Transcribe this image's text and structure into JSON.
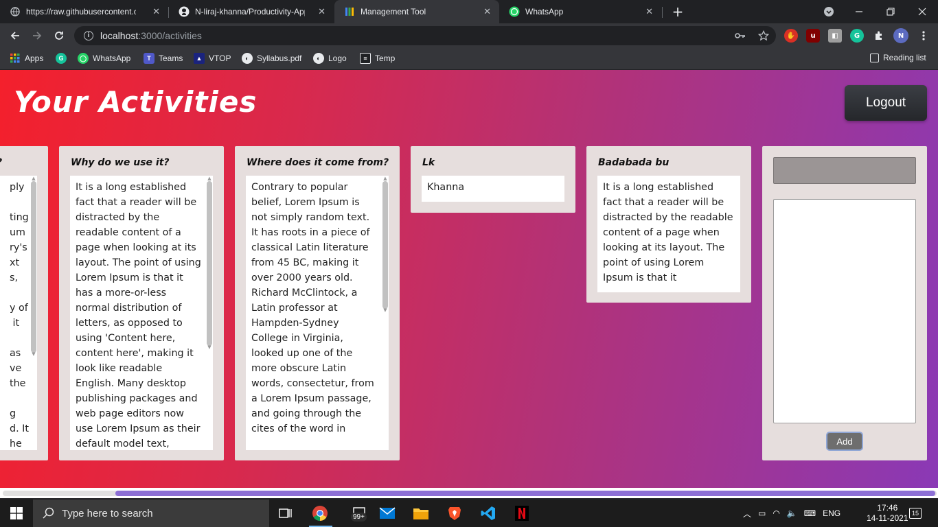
{
  "browser": {
    "tabs": [
      {
        "title": "https://raw.githubusercontent.co",
        "icon": "globe-icon"
      },
      {
        "title": "N-liraj-khanna/Productivity-App",
        "icon": "github-icon"
      },
      {
        "title": "Management Tool",
        "icon": "app-icon"
      },
      {
        "title": "WhatsApp",
        "icon": "whatsapp-icon"
      }
    ],
    "new_tab": "+",
    "close": "✕",
    "url_host": "localhost",
    "url_path": ":3000/activities",
    "bookmarks": [
      {
        "label": "Apps"
      },
      {
        "label": ""
      },
      {
        "label": "WhatsApp"
      },
      {
        "label": "Teams"
      },
      {
        "label": "VTOP"
      },
      {
        "label": "Syllabus.pdf"
      },
      {
        "label": "Logo"
      },
      {
        "label": "Temp"
      }
    ],
    "reading_list": "Reading list",
    "profile_initial": "N"
  },
  "app": {
    "title": "Your Activities",
    "logout_label": "Logout",
    "cards": [
      {
        "title": "?",
        "text": "ply\n\nting\num\nry's\nxt\ns,\n\ny of\n it\n\nas\nve\nthe\n\ng\nd. It\nhe"
      },
      {
        "title": "Why do we use it?",
        "text": "It is a long established fact that a reader will be distracted by the readable content of a page when looking at its layout. The point of using Lorem Ipsum is that it has a more-or-less normal distribution of letters, as opposed to using 'Content here, content here', making it look like readable English. Many desktop publishing packages and web page editors now use Lorem Ipsum as their default model text,"
      },
      {
        "title": "Where does it come from?",
        "text": "Contrary to popular belief, Lorem Ipsum is not simply random text. It has roots in a piece of classical Latin literature from 45 BC, making it over 2000 years old. Richard McClintock, a Latin professor at Hampden-Sydney College in Virginia, looked up one of the more obscure Latin words, consectetur, from a Lorem Ipsum passage, and going through the cites of the word in"
      },
      {
        "title": "Lk",
        "text": "Khanna"
      },
      {
        "title": "Badabada bu",
        "text": "It is a long established fact that a reader will be distracted by the readable content of a page when looking at its layout. The point of using Lorem Ipsum is that it"
      }
    ],
    "add_button": "Add",
    "colors": {
      "gradient_start": "#f4202c",
      "gradient_end": "#8a39b6",
      "card_bg": "#e6dedd"
    }
  },
  "taskbar": {
    "search_placeholder": "Type here to search",
    "mail_badge": "99+",
    "language": "ENG",
    "time": "17:46",
    "date": "14-11-2021",
    "notifications": "15"
  }
}
